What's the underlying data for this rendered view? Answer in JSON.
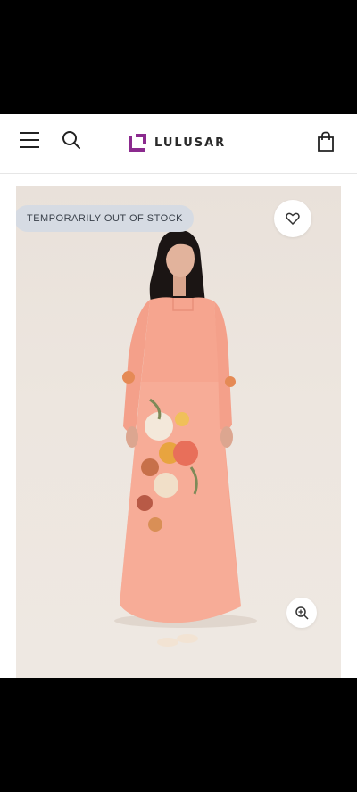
{
  "header": {
    "brand": "LULUSAR",
    "menu_icon": "hamburger-menu-icon",
    "search_icon": "search-icon",
    "cart_icon": "shopping-bag-icon",
    "brand_color": "#8b2a8e"
  },
  "product": {
    "stock_badge": "TEMPORARILY OUT OF STOCK",
    "wishlist_icon": "heart-icon",
    "zoom_icon": "zoom-in-icon",
    "dress_color": "#f6a58f"
  }
}
